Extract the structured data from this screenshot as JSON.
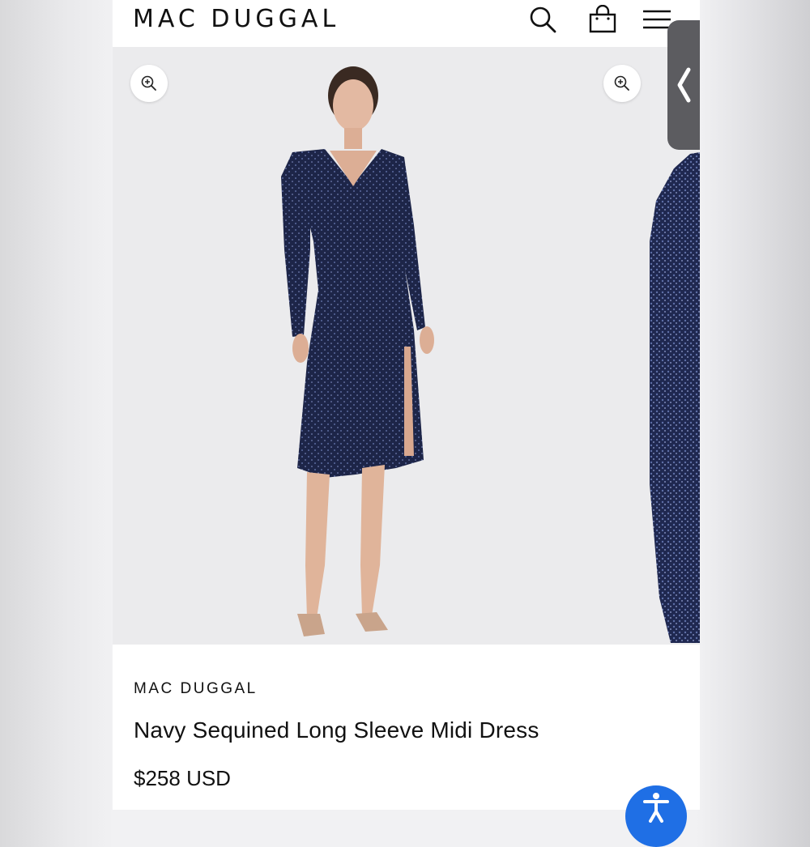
{
  "header": {
    "logo": "MAC DUGGAL",
    "icons": [
      "search-icon",
      "shopping-bag-icon",
      "hamburger-menu-icon"
    ]
  },
  "gallery": {
    "zoom_icon": "zoom-in-icon",
    "side_tab_icon": "chevron-left-icon"
  },
  "product": {
    "brand": "MAC DUGGAL",
    "name": "Navy Sequined Long Sleeve Midi Dress",
    "price": "$258 USD"
  },
  "accessibility": {
    "icon": "accessibility-icon",
    "color": "#1f6fe5"
  },
  "colors": {
    "dress": "#1c2446",
    "background": "#ebebed"
  }
}
